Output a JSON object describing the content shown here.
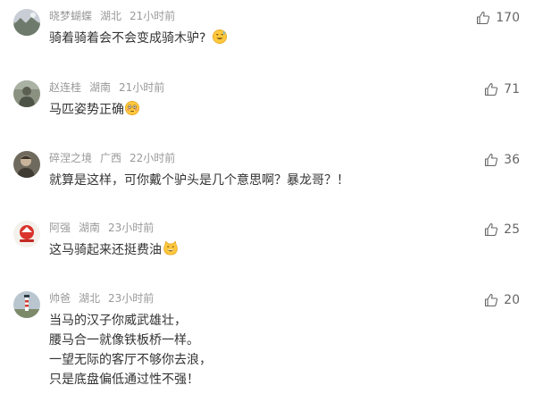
{
  "comments": [
    {
      "username": "晓梦蝴蝶",
      "location": "湖北",
      "time": "21小时前",
      "text": "骑着骑着会不会变成骑木驴?",
      "emoji": "sweat-smile-emoji",
      "likes": "170",
      "avatar": "avatar-landscape"
    },
    {
      "username": "赵连桂",
      "location": "湖南",
      "time": "21小时前",
      "text": "马匹姿势正确",
      "emoji": "flushed-face-emoji",
      "likes": "71",
      "avatar": "avatar-soldier"
    },
    {
      "username": "碎涅之境",
      "location": "广西",
      "time": "22小时前",
      "text": "就算是这样，可你戴个驴头是几个意思啊？暴龙哥？！",
      "emoji": "",
      "likes": "36",
      "avatar": "avatar-portrait"
    },
    {
      "username": "阿强",
      "location": "湖南",
      "time": "23小时前",
      "text": "这马骑起来还挺费油",
      "emoji": "cat-grin-emoji",
      "likes": "25",
      "avatar": "avatar-logo"
    },
    {
      "username": "帅爸",
      "location": "湖北",
      "time": "23小时前",
      "text_lines": [
        "当马的汉子你威武雄壮，",
        "腰马合一就像铁板桥一样。",
        "一望无际的客厅不够你去浪，",
        "只是底盘偏低通过性不强！"
      ],
      "likes": "20",
      "avatar": "avatar-lighthouse"
    }
  ],
  "colors": {
    "meta": "#999999",
    "text": "#333333",
    "like": "#666666",
    "emoji_yellow": "#FFC83D"
  }
}
